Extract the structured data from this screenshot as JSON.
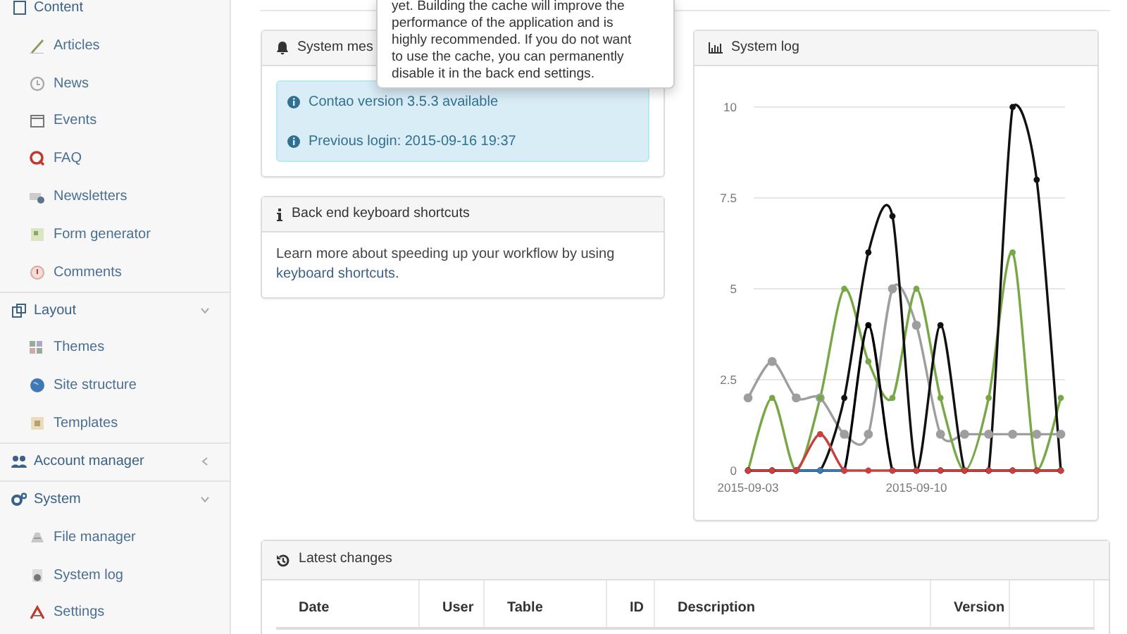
{
  "sidebar": {
    "groups": [
      {
        "label": "Content",
        "expanded": true,
        "items": [
          {
            "label": "Articles"
          },
          {
            "label": "News"
          },
          {
            "label": "Events"
          },
          {
            "label": "FAQ"
          },
          {
            "label": "Newsletters"
          },
          {
            "label": "Form generator"
          },
          {
            "label": "Comments"
          }
        ]
      },
      {
        "label": "Layout",
        "expanded": true,
        "items": [
          {
            "label": "Themes"
          },
          {
            "label": "Site structure"
          },
          {
            "label": "Templates"
          }
        ]
      },
      {
        "label": "Account manager",
        "expanded": false
      },
      {
        "label": "System",
        "expanded": true,
        "items": [
          {
            "label": "File manager"
          },
          {
            "label": "System log"
          },
          {
            "label": "Settings"
          }
        ]
      }
    ]
  },
  "tooltip": {
    "lines": [
      "yet. Building the cache will improve the",
      "performance of the application and is",
      "highly recommended. If you do not want",
      "to use the cache, you can permanently",
      "disable it in the back end settings."
    ]
  },
  "system_messages": {
    "title": "System mes",
    "messages": [
      "Contao version 3.5.3 available",
      "Previous login: 2015-09-16 19:37"
    ]
  },
  "shortcuts": {
    "title": "Back end keyboard shortcuts",
    "text": "Learn more about speeding up your workflow by using",
    "link": "keyboard shortcuts",
    "after": "."
  },
  "system_log": {
    "title": "System log",
    "chart_data": {
      "type": "line",
      "categories": [
        "2015-09-03",
        null,
        null,
        null,
        null,
        null,
        null,
        "2015-09-10",
        null,
        null,
        null,
        null,
        null,
        null
      ],
      "yticks": [
        0,
        2.5,
        5,
        7.5,
        10
      ],
      "ylim": [
        0,
        10
      ],
      "grid": true,
      "series": [
        {
          "color": "#9e9e9e",
          "marker": "circle",
          "values": [
            2,
            3,
            2,
            2,
            1,
            1,
            5,
            4,
            1,
            1,
            1,
            1,
            1,
            1
          ]
        },
        {
          "color": "#77a845",
          "marker": "circle",
          "values": [
            0,
            2,
            0,
            2,
            5,
            3,
            2,
            5,
            2,
            0,
            2,
            6,
            0,
            2
          ]
        },
        {
          "color": "#111111",
          "marker": "circle",
          "values": [
            0,
            0,
            0,
            0,
            2,
            6,
            7,
            0,
            4,
            0,
            0,
            10,
            8,
            0
          ]
        },
        {
          "color": "#000000",
          "marker": "circle",
          "values": [
            0,
            0,
            0,
            0,
            0,
            4,
            0,
            0,
            0,
            0,
            0,
            0,
            0,
            0
          ]
        },
        {
          "color": "#3a7bb5",
          "marker": "circle",
          "values": [
            null,
            null,
            0,
            0,
            0,
            null,
            null,
            null,
            null,
            null,
            null,
            null,
            null,
            null
          ]
        },
        {
          "color": "#c9413f",
          "marker": "circle",
          "values": [
            0,
            0,
            0,
            1,
            0,
            0,
            0,
            0,
            0,
            0,
            0,
            0,
            0,
            0
          ]
        }
      ]
    }
  },
  "latest_changes": {
    "title": "Latest changes",
    "columns": [
      "Date",
      "User",
      "Table",
      "ID",
      "Description",
      "Version"
    ]
  }
}
